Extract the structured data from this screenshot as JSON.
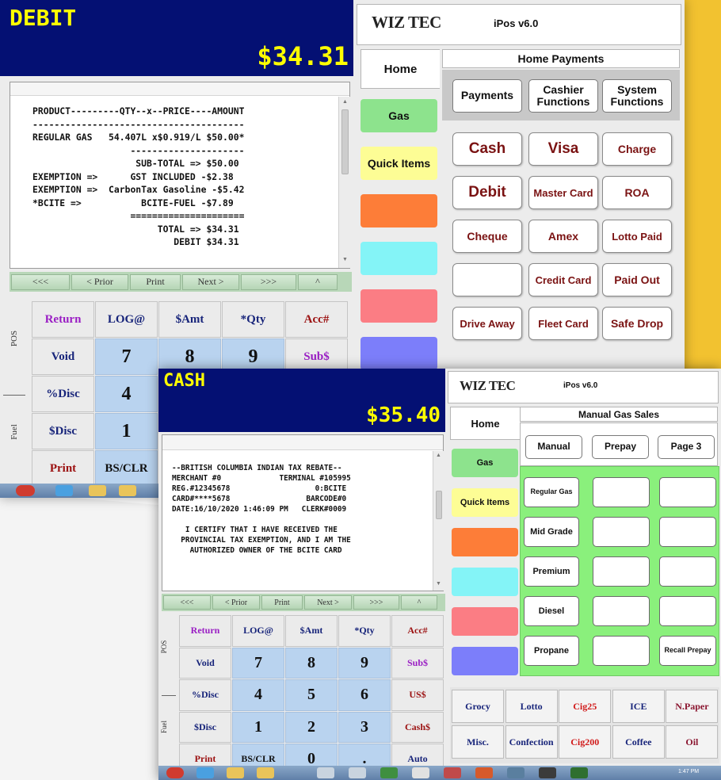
{
  "colors": {
    "title_bg": "#041073",
    "title_text": "#ffff00",
    "accent_yellow": "#f2c230",
    "tab_green": "#8de38d",
    "tab_yellow": "#fdfd95",
    "tab_orange": "#fd7d38",
    "tab_cyan": "#84f4f7",
    "tab_pink": "#fb7d84",
    "tab_blue": "#7c7efa",
    "gas_panel_green": "#8af07c",
    "keypad_blue": "#b9d3ef"
  },
  "screen1": {
    "tender_name": "DEBIT",
    "tender_amount": "$34.31",
    "receipt_lines": [
      "PRODUCT---------QTY--x--PRICE----AMOUNT",
      "---------------------------------------",
      "REGULAR GAS   54.407L x$0.919/L $50.00*",
      "                  ---------------------",
      "                   SUB-TOTAL => $50.00",
      "EXEMPTION =>      GST INCLUDED -$2.38",
      "EXEMPTION =>  CarbonTax Gasoline -$5.42",
      "*BCITE =>           BCITE-FUEL -$7.89",
      "                  =====================",
      "                       TOTAL => $34.31",
      "                          DEBIT $34.31"
    ],
    "nav": [
      "<<<",
      "< Prior",
      "Print",
      "Next >",
      ">>>",
      "^"
    ],
    "side_labels": [
      "POS",
      "Fuel"
    ],
    "keypad_rows": [
      [
        "Return",
        "LOG@",
        "$Amt",
        "*Qty",
        "Acc#"
      ],
      [
        "Void",
        "7",
        "8",
        "9",
        "Sub$"
      ],
      [
        "%Disc",
        "4",
        "",
        "",
        ""
      ],
      [
        "$Disc",
        "1",
        "",
        "",
        ""
      ],
      [
        "Print",
        "BS/CLR",
        "",
        "",
        ""
      ]
    ],
    "logo": "WIZ TEC",
    "version": "iPos v6.0",
    "home_tab": "Home",
    "side_tabs": [
      "Gas",
      "Quick Items",
      "",
      "",
      "",
      ""
    ],
    "panel_title": "Home Payments",
    "sub_tabs": [
      "Payments",
      "Cashier Functions",
      "System Functions"
    ],
    "payment_buttons": [
      [
        "Cash",
        "Visa",
        "Charge"
      ],
      [
        "Debit",
        "Master Card",
        "ROA"
      ],
      [
        "Cheque",
        "Amex",
        "Lotto Paid"
      ],
      [
        "",
        "Credit Card",
        "Paid Out"
      ],
      [
        "Drive Away",
        "Fleet Card",
        "Safe Drop"
      ]
    ]
  },
  "screen2": {
    "tender_name": "CASH",
    "tender_amount": "$35.40",
    "receipt_lines": [
      "",
      "--BRITISH COLUMBIA INDIAN TAX REBATE--",
      "MERCHANT #0             TERMINAL #105995",
      "REG.#12345678                   0:BCITE",
      "CARD#****5678                 BARCODE#0",
      "DATE:16/10/2020 1:46:09 PM   CLERK#0009",
      "",
      "   I CERTIFY THAT I HAVE RECEIVED THE",
      "  PROVINCIAL TAX EXEMPTION, AND I AM THE",
      "    AUTHORIZED OWNER OF THE BCITE CARD"
    ],
    "nav": [
      "<<<",
      "< Prior",
      "Print",
      "Next >",
      ">>>",
      "^"
    ],
    "side_labels": [
      "POS",
      "Fuel"
    ],
    "keypad_rows": [
      [
        "Return",
        "LOG@",
        "$Amt",
        "*Qty",
        "Acc#"
      ],
      [
        "Void",
        "7",
        "8",
        "9",
        "Sub$"
      ],
      [
        "%Disc",
        "4",
        "5",
        "6",
        "US$"
      ],
      [
        "$Disc",
        "1",
        "2",
        "3",
        "Cash$"
      ],
      [
        "Print",
        "BS/CLR",
        "0",
        ".",
        "Auto"
      ]
    ],
    "logo": "WIZ TEC",
    "version": "iPos v6.0",
    "home_tab": "Home",
    "side_tabs": [
      "Gas",
      "Quick Items",
      "",
      "",
      "",
      ""
    ],
    "panel_title": "Manual Gas Sales",
    "sub_tabs": [
      "Manual",
      "Prepay",
      "Page 3"
    ],
    "gas_buttons": [
      [
        "Regular Gas",
        "",
        ""
      ],
      [
        "Mid Grade",
        "",
        ""
      ],
      [
        "Premium",
        "",
        ""
      ],
      [
        "Diesel",
        "",
        ""
      ],
      [
        "Propane",
        "",
        "Recall Prepay"
      ]
    ],
    "categories": [
      [
        "Grocy",
        "Lotto",
        "Cig25",
        "ICE",
        "N.Paper"
      ],
      [
        "Misc.",
        "Confection",
        "Cig200",
        "Coffee",
        "Oil"
      ]
    ],
    "taskbar_time": "1:47 PM"
  }
}
